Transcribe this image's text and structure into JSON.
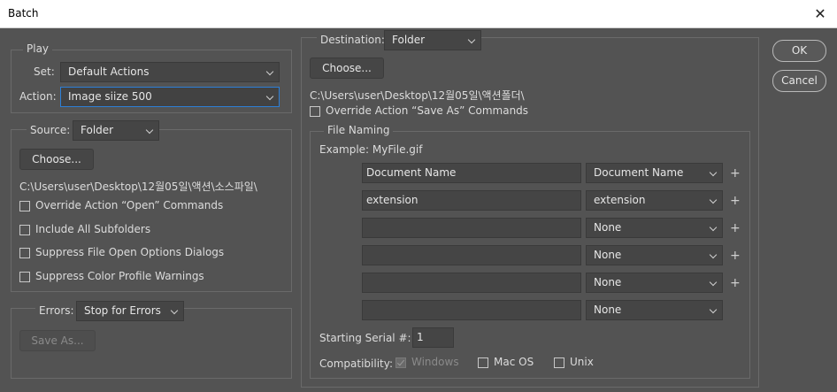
{
  "window": {
    "title": "Batch",
    "close_glyph": "✕"
  },
  "play": {
    "legend": "Play",
    "set_label": "Set:",
    "set_value": "Default Actions",
    "action_label": "Action:",
    "action_value": "Image siize 500"
  },
  "source": {
    "label": "Source:",
    "value": "Folder",
    "choose_label": "Choose...",
    "path": "C:\\Users\\user\\Desktop\\12월05일\\액션\\소스파일\\",
    "checkboxes": [
      {
        "label": "Override Action “Open” Commands",
        "checked": false
      },
      {
        "label": "Include All Subfolders",
        "checked": false
      },
      {
        "label": "Suppress File Open Options Dialogs",
        "checked": false
      },
      {
        "label": "Suppress Color Profile Warnings",
        "checked": false
      }
    ]
  },
  "errors": {
    "label": "Errors:",
    "value": "Stop for Errors",
    "save_as_label": "Save As..."
  },
  "destination": {
    "label": "Destination:",
    "value": "Folder",
    "choose_label": "Choose...",
    "path": "C:\\Users\\user\\Desktop\\12월05일\\액션폴더\\",
    "override_label": "Override Action “Save As” Commands"
  },
  "file_naming": {
    "legend": "File Naming",
    "example": "Example: MyFile.gif",
    "rows": [
      {
        "text": "Document Name",
        "select": "Document Name",
        "plus": "+"
      },
      {
        "text": "extension",
        "select": "extension",
        "plus": "+"
      },
      {
        "text": "",
        "select": "None",
        "plus": "+"
      },
      {
        "text": "",
        "select": "None",
        "plus": "+"
      },
      {
        "text": "",
        "select": "None",
        "plus": "+"
      },
      {
        "text": "",
        "select": "None",
        "plus": ""
      }
    ],
    "serial_label": "Starting Serial #:",
    "serial_value": "1",
    "compat_label": "Compatibility:",
    "compat": [
      {
        "label": "Windows",
        "checked": true,
        "disabled": true
      },
      {
        "label": "Mac OS",
        "checked": false,
        "disabled": false
      },
      {
        "label": "Unix",
        "checked": false,
        "disabled": false
      }
    ]
  },
  "buttons": {
    "ok": "OK",
    "cancel": "Cancel"
  }
}
